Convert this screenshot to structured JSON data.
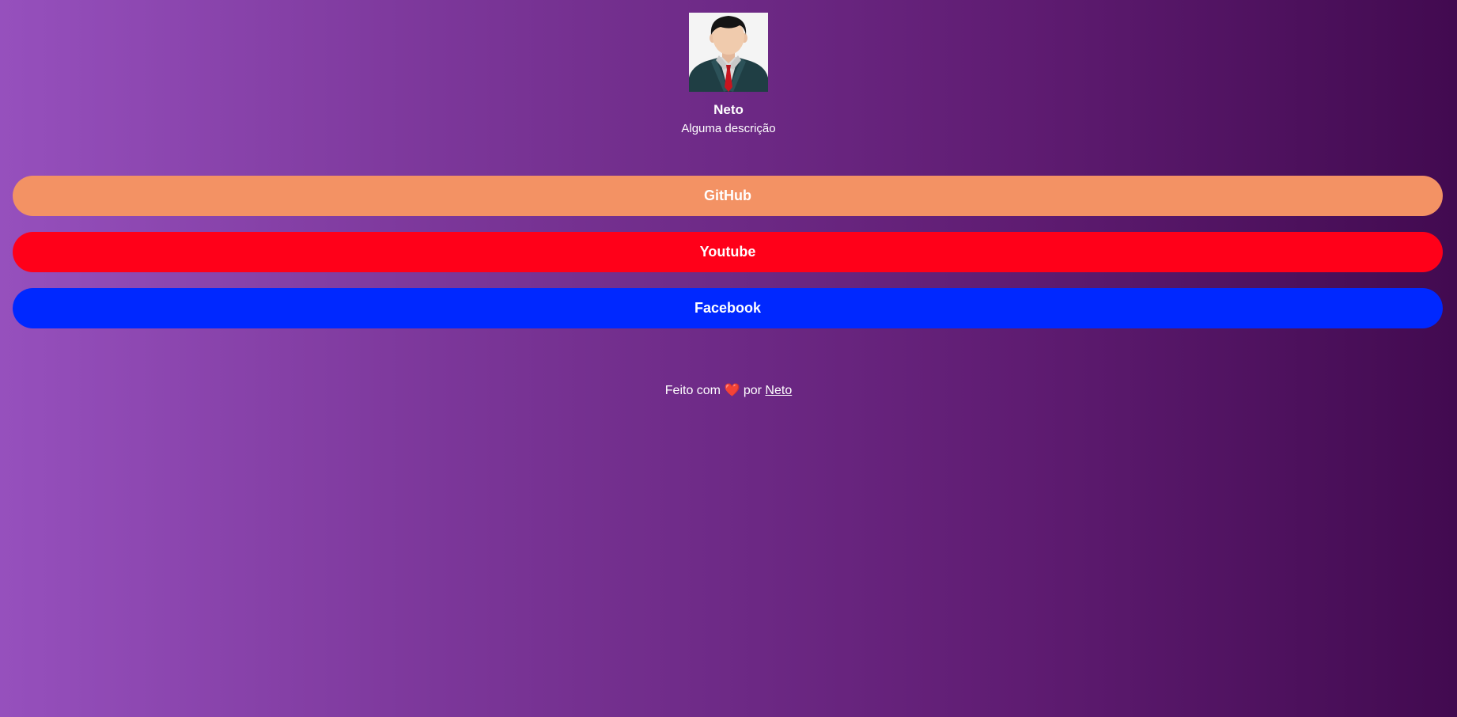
{
  "profile": {
    "avatar_icon": "person-in-suit-avatar",
    "name": "Neto",
    "description": "Alguma descrição"
  },
  "links": [
    {
      "label": "GitHub",
      "color": "#f39264"
    },
    {
      "label": "Youtube",
      "color": "#ff0019"
    },
    {
      "label": "Facebook",
      "color": "#0028ff"
    }
  ],
  "footer": {
    "prefix": "Feito com",
    "heart": "❤️",
    "middle": "por",
    "author_link": "Neto"
  }
}
